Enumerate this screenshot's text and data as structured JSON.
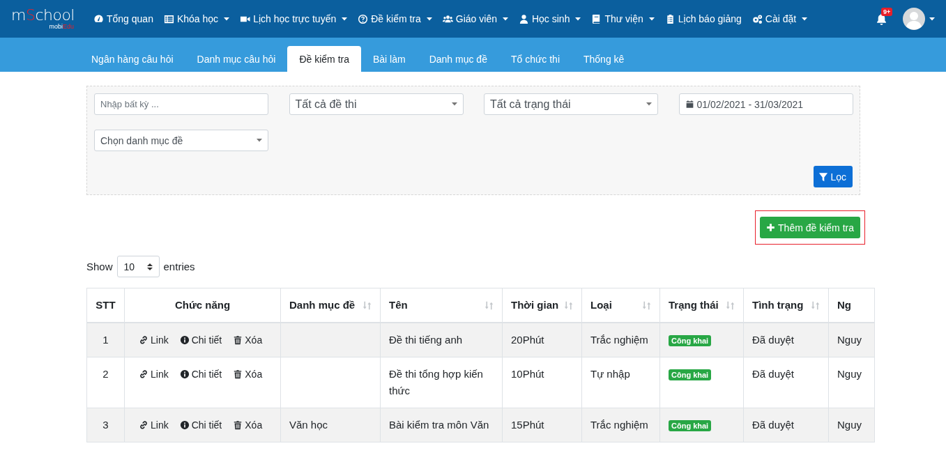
{
  "logo": {
    "title_parts": [
      {
        "text": "m",
        "accent": false
      },
      {
        "text": "S",
        "accent": true
      },
      {
        "text": "chool",
        "accent": false
      }
    ],
    "subtitle_parts": [
      {
        "text": "mobi",
        "accent": false
      },
      {
        "text": "Edu",
        "accent": true
      }
    ]
  },
  "nav": [
    {
      "label": "Tổng quan",
      "has_menu": false
    },
    {
      "label": "Khóa học",
      "has_menu": true
    },
    {
      "label": "Lịch học trực tuyến",
      "has_menu": true
    },
    {
      "label": "Đề kiểm tra",
      "has_menu": true
    },
    {
      "label": "Giáo viên",
      "has_menu": true
    },
    {
      "label": "Học sinh",
      "has_menu": true
    },
    {
      "label": "Thư viện",
      "has_menu": true
    },
    {
      "label": "Lịch báo giảng",
      "has_menu": false
    },
    {
      "label": "Cài đặt",
      "has_menu": true
    }
  ],
  "notifications": {
    "badge": "9+"
  },
  "subtabs": [
    {
      "label": "Ngân hàng câu hỏi",
      "selected": false
    },
    {
      "label": "Danh mục câu hỏi",
      "selected": false
    },
    {
      "label": "Đề kiểm tra",
      "selected": true
    },
    {
      "label": "Bài làm",
      "selected": false
    },
    {
      "label": "Danh mục đề",
      "selected": false
    },
    {
      "label": "Tổ chức thi",
      "selected": false
    },
    {
      "label": "Thống kê",
      "selected": false
    }
  ],
  "filters": [
    {
      "kind": "text",
      "placeholder": "Nhập bất kỳ ..."
    },
    {
      "kind": "select",
      "value": "Tất cả đề thi"
    },
    {
      "kind": "select",
      "value": "Tất cả trạng thái"
    },
    {
      "kind": "date",
      "value": "01/02/2021 - 31/03/2021"
    },
    {
      "kind": "select-small",
      "value": "Chọn danh mục đề"
    }
  ],
  "filter_button": {
    "label": "Lọc"
  },
  "add_button": {
    "label": "Thêm đề kiểm tra",
    "highlighted": true
  },
  "entries": {
    "before": "Show",
    "value": "10",
    "after": "entries"
  },
  "table": {
    "columns": [
      {
        "label": "STT",
        "sortable": false
      },
      {
        "label": "Chức năng",
        "sortable": false
      },
      {
        "label": "Danh mục đề",
        "sortable": true
      },
      {
        "label": "Tên",
        "sortable": true
      },
      {
        "label": "Thời gian",
        "sortable": true
      },
      {
        "label": "Loại",
        "sortable": true
      },
      {
        "label": "Trạng thái",
        "sortable": true
      },
      {
        "label": "Tình trạng",
        "sortable": true
      },
      {
        "label": "Ng",
        "sortable": false
      }
    ],
    "rows": [
      {
        "stt": "1",
        "actions": [
          {
            "kind": "link",
            "label": "Link"
          },
          {
            "kind": "info",
            "label": "Chi tiết"
          },
          {
            "kind": "delete",
            "label": "Xóa"
          }
        ],
        "category": "",
        "name": "Đề thi tiếng anh",
        "time": "20Phút",
        "type": "Trắc nghiệm",
        "status": "Công khai",
        "state": "Đã duyệt",
        "column_9": "Nguy"
      },
      {
        "stt": "2",
        "actions": [
          {
            "kind": "link",
            "label": "Link"
          },
          {
            "kind": "info",
            "label": "Chi tiết"
          },
          {
            "kind": "delete",
            "label": "Xóa"
          }
        ],
        "category": "",
        "name": "Đề thi tổng hợp kiến thức",
        "time": "10Phút",
        "type": "Tự nhập",
        "status": "Công khai",
        "state": "Đã duyệt",
        "column_9": "Nguy"
      },
      {
        "stt": "3",
        "actions": [
          {
            "kind": "link",
            "label": "Link"
          },
          {
            "kind": "info",
            "label": "Chi tiết"
          },
          {
            "kind": "delete",
            "label": "Xóa"
          }
        ],
        "category": "Văn học",
        "name": "Bài kiểm tra môn Văn",
        "time": "15Phút",
        "type": "Trắc nghiệm",
        "status": "Công khai",
        "state": "Đã duyệt",
        "column_9": "Nguy"
      }
    ]
  }
}
